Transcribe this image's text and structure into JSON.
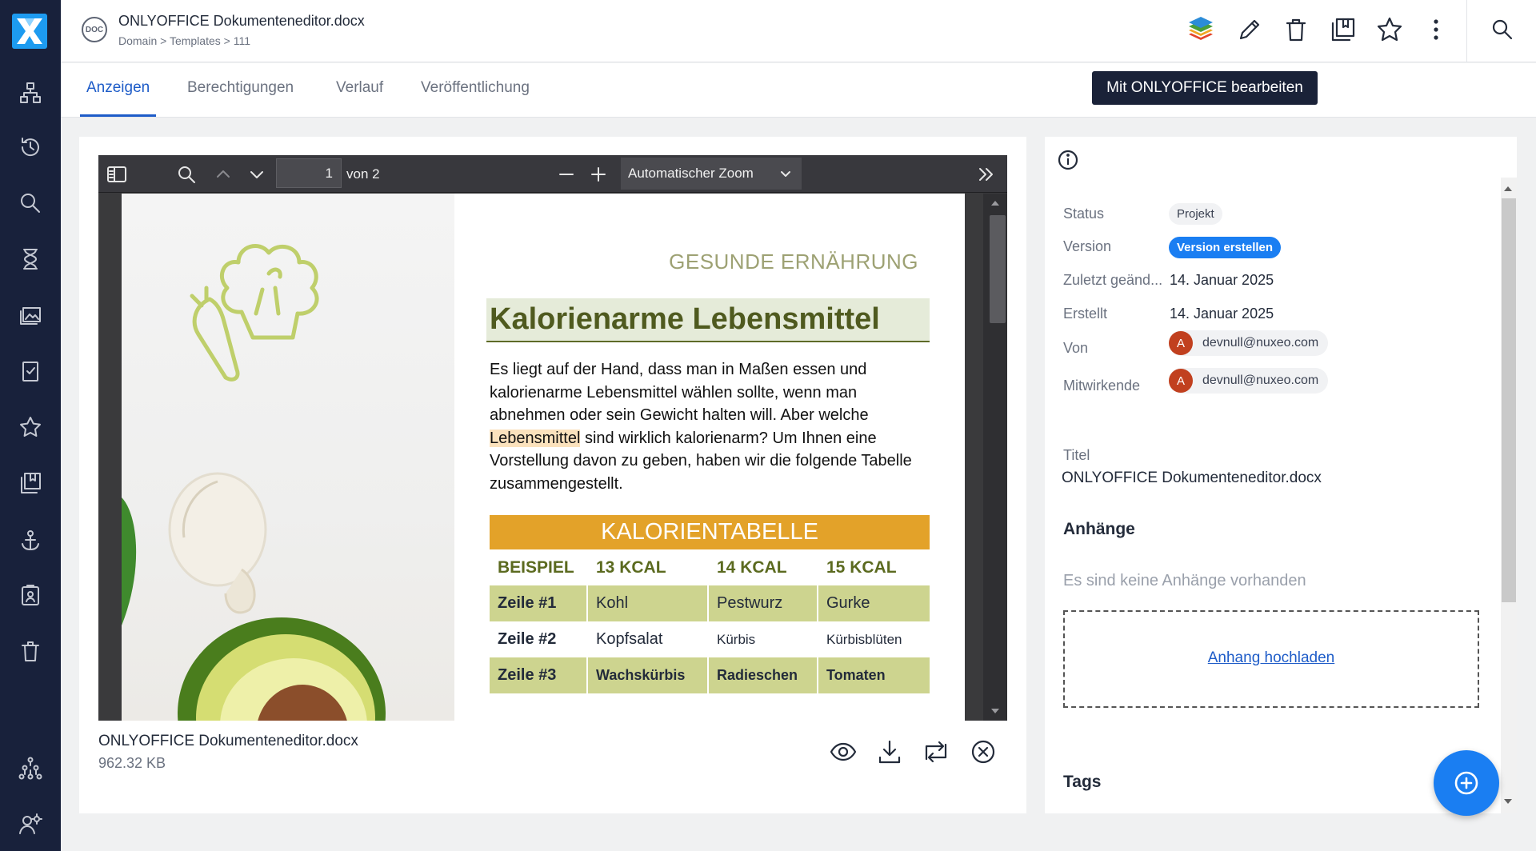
{
  "header": {
    "doc_badge": "DOC",
    "title": "ONLYOFFICE Dokumenteneditor.docx",
    "breadcrumb": "Domain > Templates > 111"
  },
  "tabs": [
    {
      "label": "Anzeigen",
      "active": true
    },
    {
      "label": "Berechtigungen"
    },
    {
      "label": "Verlauf"
    },
    {
      "label": "Veröffentlichung"
    }
  ],
  "tooltip": "Mit ONLYOFFICE bearbeiten",
  "viewer": {
    "page_current": "1",
    "page_total": "von 2",
    "zoom": "Automatischer Zoom",
    "document": {
      "kicker": "GESUNDE ERNÄHRUNG",
      "heading": "Kalorienarme Lebensmittel",
      "para_before": "Es liegt auf der Hand, dass man in Maßen essen und kalorienarme Lebensmittel wählen sollte, wenn man abnehmen oder sein Gewicht halten will. Aber welche",
      "para_highlight": "Lebensmittel",
      "para_after": "sind wirklich kalorienarm? Um Ihnen eine Vorstellung davon zu geben, haben wir die folgende Tabelle zusammengestellt.",
      "table_title": "KALORIENTABELLE",
      "table_head": [
        "BEISPIEL",
        "13 KCAL",
        "14 KCAL",
        "15 KCAL"
      ],
      "rows": [
        [
          "Zeile #1",
          "Kohl",
          "Pestwurz",
          "Gurke"
        ],
        [
          "Zeile #2",
          "Kopfsalat",
          "Kürbis",
          "Kürbisblüten"
        ],
        [
          "Zeile #3",
          "Wachskürbis",
          "Radieschen",
          "Tomaten"
        ]
      ]
    }
  },
  "file": {
    "name": "ONLYOFFICE Dokumenteneditor.docx",
    "size": "962.32 KB"
  },
  "details": {
    "status_label": "Status",
    "status_value": "Projekt",
    "version_label": "Version",
    "version_button": "Version erstellen",
    "modified_label": "Zuletzt geänd...",
    "modified_value": "14. Januar 2025",
    "created_label": "Erstellt",
    "created_value": "14. Januar 2025",
    "by_label": "Von",
    "by_user": "devnull@nuxeo.com",
    "contributors_label": "Mitwirkende",
    "contributor_user": "devnull@nuxeo.com",
    "avatar_letter": "A",
    "title_label": "Titel",
    "title_value": "ONLYOFFICE Dokumenteneditor.docx",
    "attachments_heading": "Anhänge",
    "attachments_empty": "Es sind keine Anhänge vorhanden",
    "upload_link": "Anhang hochladen",
    "tags_heading": "Tags"
  },
  "colors": {
    "rail": "#18213b",
    "accent": "#1e5cc8",
    "fab": "#1a7ef2",
    "table_orange": "#e3a229",
    "table_green": "#cdd48f"
  }
}
